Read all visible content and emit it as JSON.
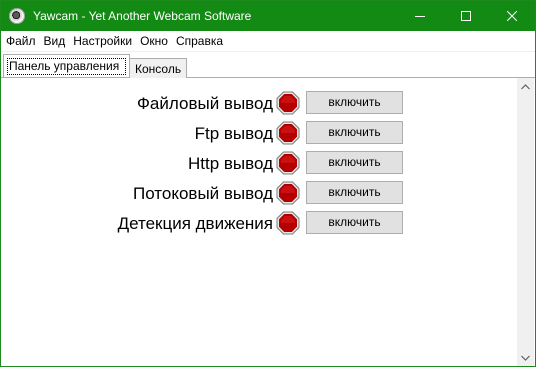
{
  "window": {
    "title": "Yawcam - Yet Another Webcam Software",
    "icon": "webcam-icon",
    "accent_color": "#138a13"
  },
  "menu": {
    "items": [
      {
        "label": "Файл"
      },
      {
        "label": "Вид"
      },
      {
        "label": "Настройки"
      },
      {
        "label": "Окно"
      },
      {
        "label": "Справка"
      }
    ]
  },
  "tabs": [
    {
      "label": "Панель управления",
      "active": true
    },
    {
      "label": "Консоль",
      "active": false
    }
  ],
  "controls": [
    {
      "label": "Файловый вывод",
      "status": "stopped",
      "status_color": "#c40000",
      "button": "включить"
    },
    {
      "label": "Ftp вывод",
      "status": "stopped",
      "status_color": "#c40000",
      "button": "включить"
    },
    {
      "label": "Http вывод",
      "status": "stopped",
      "status_color": "#c40000",
      "button": "включить"
    },
    {
      "label": "Потоковый вывод",
      "status": "stopped",
      "status_color": "#c40000",
      "button": "включить"
    },
    {
      "label": "Детекция движения",
      "status": "stopped",
      "status_color": "#c40000",
      "button": "включить"
    }
  ]
}
